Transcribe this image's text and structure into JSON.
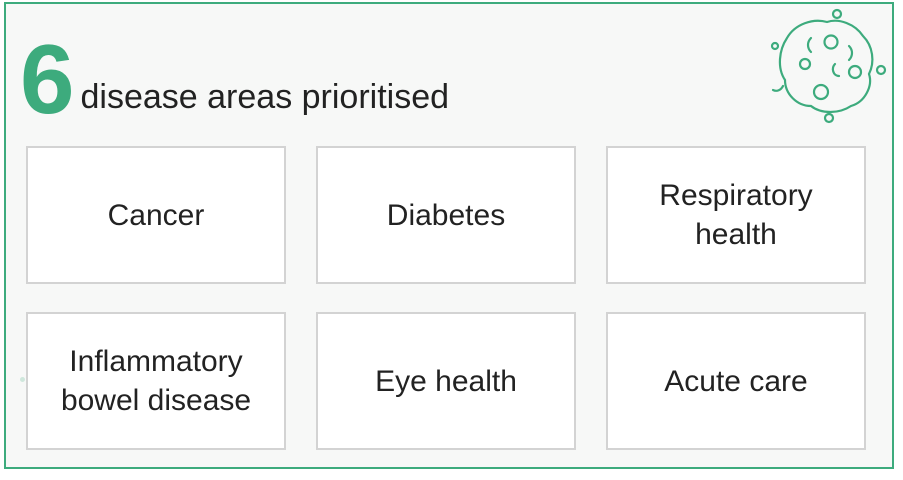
{
  "headline": {
    "number": "6",
    "text": "disease areas prioritised"
  },
  "icon": "virus-icon",
  "accent_color": "#3dab7d",
  "areas": [
    "Cancer",
    "Diabetes",
    "Respiratory\nhealth",
    "Inflammatory\nbowel disease",
    "Eye health",
    "Acute care"
  ]
}
